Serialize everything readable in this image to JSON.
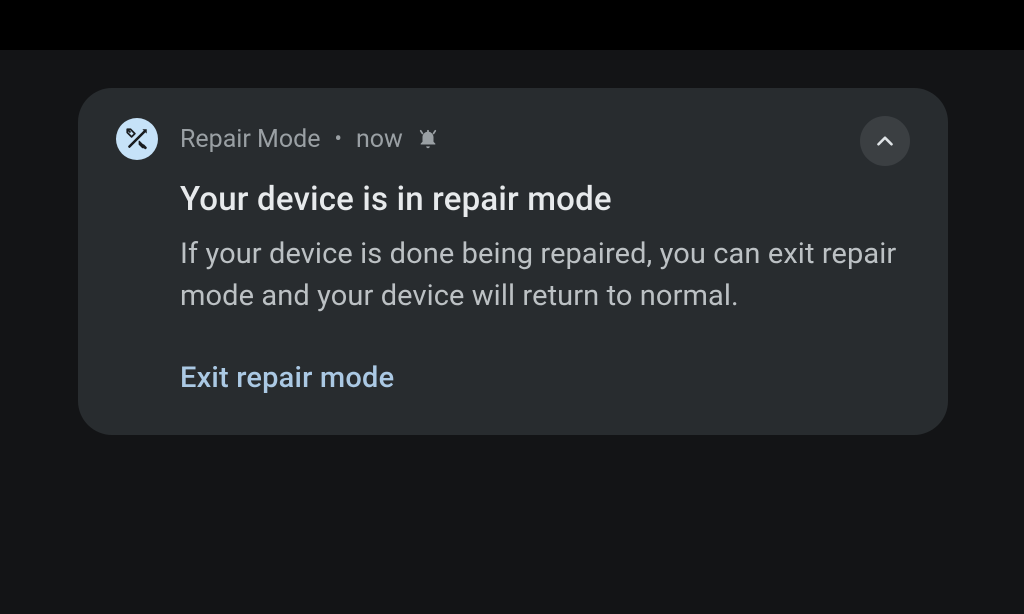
{
  "notification": {
    "app_name": "Repair Mode",
    "time": "now",
    "title": "Your device is in repair mode",
    "description": "If your device is done being repaired, you can exit repair mode and your device will return to normal.",
    "action_label": "Exit repair mode"
  },
  "colors": {
    "background": "#131416",
    "card": "#282c2f",
    "icon_bg": "#c6e2f8",
    "action": "#abc9e4"
  }
}
